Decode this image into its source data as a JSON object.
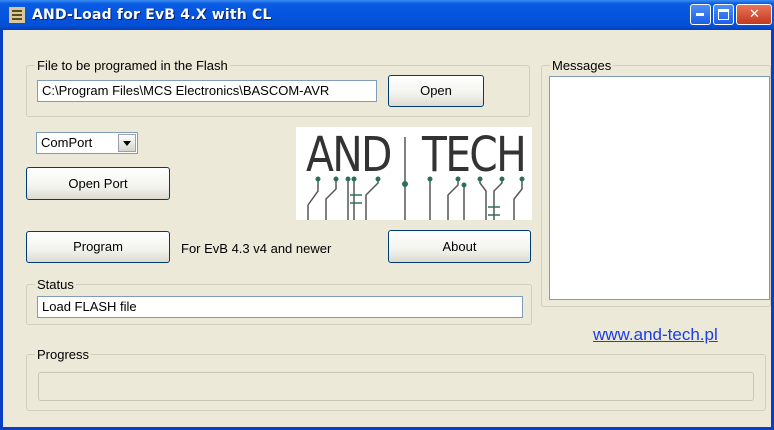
{
  "window": {
    "title": "AND-Load for EvB 4.X with CL"
  },
  "flash_group": {
    "legend": "File to be programed in the Flash",
    "path_value": "C:\\Program Files\\MCS Electronics\\BASCOM-AVR",
    "open_label": "Open"
  },
  "comport": {
    "selected": "ComPort"
  },
  "open_port_label": "Open Port",
  "logo": {
    "text_left": "AND",
    "text_right": "TECH"
  },
  "program_label": "Program",
  "evb_note": "For EvB 4.3 v4 and newer",
  "about_label": "About",
  "status_group": {
    "legend": "Status",
    "value": "Load FLASH file"
  },
  "messages_group": {
    "legend": "Messages"
  },
  "website": "www.and-tech.pl",
  "progress_group": {
    "legend": "Progress"
  },
  "colors": {
    "titlebar": "#0654de",
    "window_bg": "#ece9d8",
    "link": "#1a3ee0",
    "logo_trace": "#2d6f5a"
  }
}
